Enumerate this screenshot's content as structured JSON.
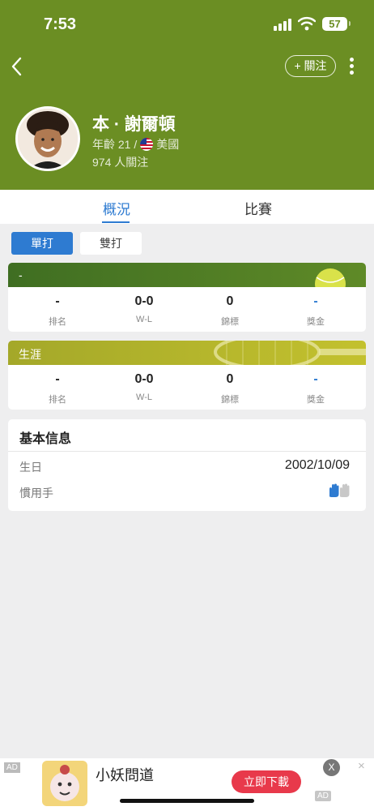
{
  "status_bar": {
    "time": "7:53",
    "battery": "57"
  },
  "header": {
    "follow_label": "+ 關注",
    "player_name": "本 · 謝爾頓",
    "age_text": "年齡 21 /",
    "country": "美國",
    "followers": "974 人關注"
  },
  "tabs": [
    {
      "label": "概況"
    },
    {
      "label": "比賽"
    }
  ],
  "segments": [
    {
      "label": "單打"
    },
    {
      "label": "雙打"
    }
  ],
  "current_card": {
    "title": "-",
    "stats": [
      {
        "value": "-",
        "label": "排名"
      },
      {
        "value": "0-0",
        "label": "W-L"
      },
      {
        "value": "0",
        "label": "錦標"
      },
      {
        "value": "-",
        "label": "獎金"
      }
    ]
  },
  "career_card": {
    "title": "生涯",
    "stats": [
      {
        "value": "-",
        "label": "排名"
      },
      {
        "value": "0-0",
        "label": "W-L"
      },
      {
        "value": "0",
        "label": "錦標"
      },
      {
        "value": "-",
        "label": "獎金"
      }
    ]
  },
  "info": {
    "title": "基本信息",
    "birthday_label": "生日",
    "birthday_value": "2002/10/09",
    "handedness_label": "慣用手",
    "handedness_icon": "left-hand-icon"
  },
  "ad": {
    "tag": "AD",
    "title": "小妖問道",
    "cta": "立即下載",
    "close": "X",
    "dismiss": "×",
    "corner_tag": "AD"
  },
  "colors": {
    "header_green": "#6b8e23",
    "accent_blue": "#2e7bd1",
    "current_card_head": "#557a22",
    "career_card_head": "#b5b52a",
    "cta_red": "#e8394b"
  }
}
